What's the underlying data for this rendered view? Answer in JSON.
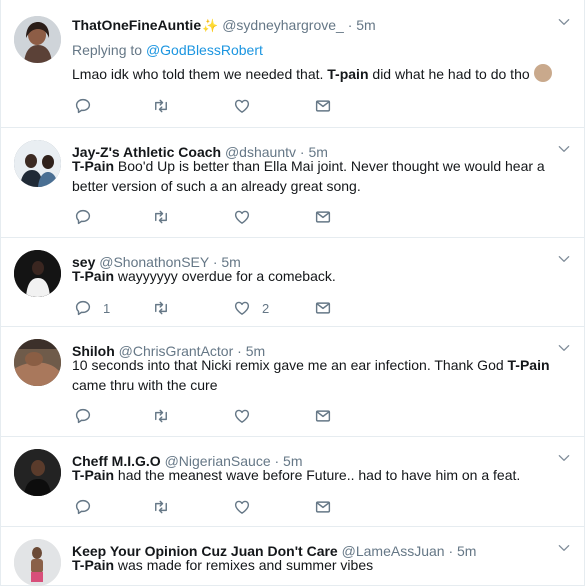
{
  "tweets": [
    {
      "name": "ThatOneFineAuntie",
      "handle": "@sydneyhargrove_",
      "time": "· 5m",
      "replying_prefix": "Replying to ",
      "replying_to": "@GodBlessRobert",
      "text_before": "Lmao idk who told them we needed that. ",
      "bold": "T-pain",
      "text_after": " did what he had to do tho"
    },
    {
      "name": "Jay-Z's Athletic Coach",
      "handle": "@dshauntv",
      "time": "· 5m",
      "bold": "T-Pain",
      "text_after": " Boo'd Up is better than Ella Mai joint. Never thought we would hear a better version of such a an already great song."
    },
    {
      "name": "sey",
      "handle": "@ShonathonSEY",
      "time": "· 5m",
      "bold": "T-Pain",
      "text_after": " wayyyyyy overdue for a comeback.",
      "reply_count": "1",
      "like_count": "2"
    },
    {
      "name": "Shiloh",
      "handle": "@ChrisGrantActor",
      "time": "· 5m",
      "text_before": "10 seconds into that Nicki remix gave me an ear infection. Thank God ",
      "bold": "T-Pain",
      "text_after": " came thru with the cure"
    },
    {
      "name": "Cheff M.I.G.O",
      "handle": "@NigerianSauce",
      "time": "· 5m",
      "bold": "T-Pain",
      "text_after": " had the meanest wave before Future.. had to have him on a feat."
    },
    {
      "name": "Keep Your Opinion Cuz Juan Don't Care",
      "handle": "@LameAssJuan",
      "time": "· 5m",
      "bold": "T-Pain",
      "text_after": " was made for remixes and summer vibes"
    }
  ],
  "colors": {
    "accent": "#1b95e0",
    "muted": "#657786",
    "text": "#14171a",
    "divider": "#e6ecf0"
  },
  "icons": [
    "reply-icon",
    "retweet-icon",
    "like-icon",
    "message-icon",
    "chevron-down-icon",
    "sparkle-icon",
    "clap-emoji"
  ]
}
